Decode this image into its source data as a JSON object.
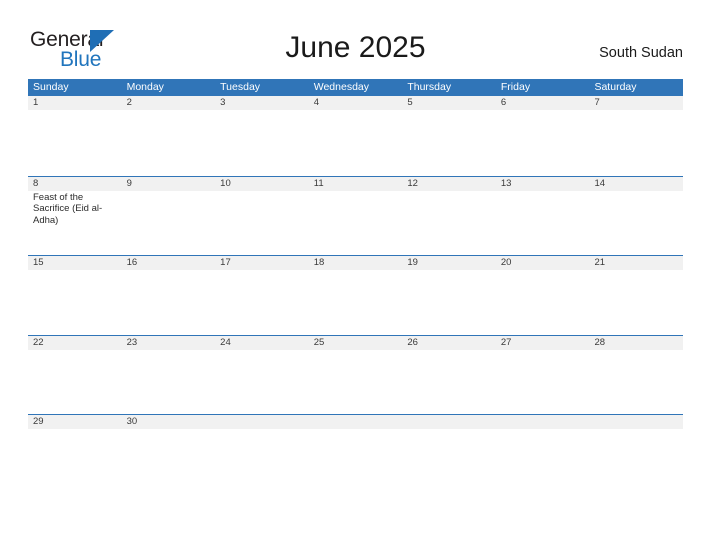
{
  "logo": {
    "word_one": "General",
    "word_two": "Blue",
    "triangle_color": "#1f6eb5",
    "blue_text_color": "#2175bd"
  },
  "header": {
    "title": "June 2025",
    "region": "South Sudan"
  },
  "theme": {
    "header_blue": "#3075b8",
    "row_band_gray": "#f1f1f1",
    "page_background": "#ffffff"
  },
  "calendar": {
    "weekdays": [
      "Sunday",
      "Monday",
      "Tuesday",
      "Wednesday",
      "Thursday",
      "Friday",
      "Saturday"
    ],
    "weeks": [
      {
        "days": [
          {
            "number": "1",
            "events": []
          },
          {
            "number": "2",
            "events": []
          },
          {
            "number": "3",
            "events": []
          },
          {
            "number": "4",
            "events": []
          },
          {
            "number": "5",
            "events": []
          },
          {
            "number": "6",
            "events": []
          },
          {
            "number": "7",
            "events": []
          }
        ]
      },
      {
        "days": [
          {
            "number": "8",
            "events": [
              "Feast of the Sacrifice (Eid al-Adha)"
            ]
          },
          {
            "number": "9",
            "events": []
          },
          {
            "number": "10",
            "events": []
          },
          {
            "number": "11",
            "events": []
          },
          {
            "number": "12",
            "events": []
          },
          {
            "number": "13",
            "events": []
          },
          {
            "number": "14",
            "events": []
          }
        ]
      },
      {
        "days": [
          {
            "number": "15",
            "events": []
          },
          {
            "number": "16",
            "events": []
          },
          {
            "number": "17",
            "events": []
          },
          {
            "number": "18",
            "events": []
          },
          {
            "number": "19",
            "events": []
          },
          {
            "number": "20",
            "events": []
          },
          {
            "number": "21",
            "events": []
          }
        ]
      },
      {
        "days": [
          {
            "number": "22",
            "events": []
          },
          {
            "number": "23",
            "events": []
          },
          {
            "number": "24",
            "events": []
          },
          {
            "number": "25",
            "events": []
          },
          {
            "number": "26",
            "events": []
          },
          {
            "number": "27",
            "events": []
          },
          {
            "number": "28",
            "events": []
          }
        ]
      },
      {
        "days": [
          {
            "number": "29",
            "events": []
          },
          {
            "number": "30",
            "events": []
          },
          {
            "number": "",
            "events": []
          },
          {
            "number": "",
            "events": []
          },
          {
            "number": "",
            "events": []
          },
          {
            "number": "",
            "events": []
          },
          {
            "number": "",
            "events": []
          }
        ]
      }
    ]
  }
}
